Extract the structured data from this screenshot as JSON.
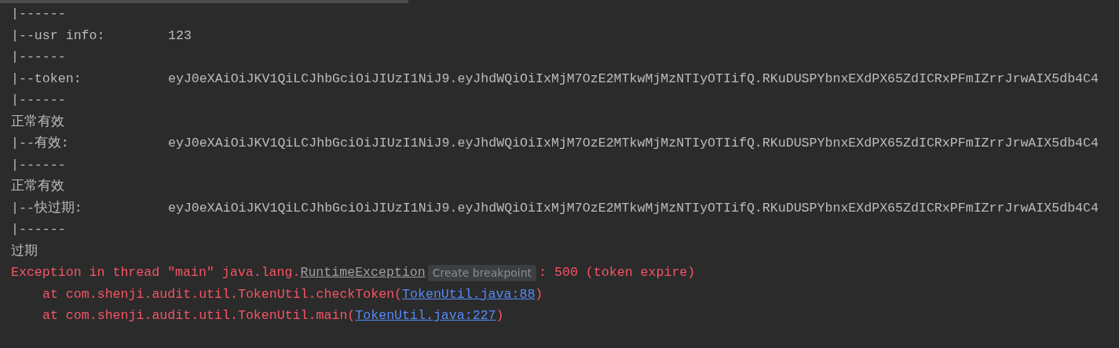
{
  "console": {
    "lines": [
      {
        "kind": "plain",
        "text": "|------"
      },
      {
        "kind": "field",
        "label": "|--usr info:",
        "value": "123"
      },
      {
        "kind": "plain",
        "text": "|------"
      },
      {
        "kind": "field",
        "label": "|--token:",
        "value": "eyJ0eXAiOiJKV1QiLCJhbGciOiJIUzI1NiJ9.eyJhdWQiOiIxMjM7OzE2MTkwMjMzNTIyOTIifQ.RKuDUSPYbnxEXdPX65ZdICRxPFmIZrrJrwAIX5db4C4"
      },
      {
        "kind": "plain",
        "text": "|------"
      },
      {
        "kind": "plain",
        "text": "正常有效"
      },
      {
        "kind": "field",
        "label": "|--有效:",
        "value": "eyJ0eXAiOiJKV1QiLCJhbGciOiJIUzI1NiJ9.eyJhdWQiOiIxMjM7OzE2MTkwMjMzNTIyOTIifQ.RKuDUSPYbnxEXdPX65ZdICRxPFmIZrrJrwAIX5db4C4"
      },
      {
        "kind": "plain",
        "text": "|------"
      },
      {
        "kind": "plain",
        "text": "正常有效"
      },
      {
        "kind": "field",
        "label": "|--快过期:",
        "value": "eyJ0eXAiOiJKV1QiLCJhbGciOiJIUzI1NiJ9.eyJhdWQiOiIxMjM7OzE2MTkwMjMzNTIyOTIifQ.RKuDUSPYbnxEXdPX65ZdICRxPFmIZrrJrwAIX5db4C4"
      },
      {
        "kind": "plain",
        "text": "|------"
      },
      {
        "kind": "plain",
        "text": "过期"
      },
      {
        "kind": "exception",
        "prefix": "Exception in thread \"main\" java.lang.",
        "link": "RuntimeException",
        "tooltip": "Create breakpoint",
        "suffix": ": 500 (token expire)"
      },
      {
        "kind": "trace",
        "prefix": "at com.shenji.audit.util.TokenUtil.checkToken(",
        "link": "TokenUtil.java:88",
        "suffix": ")"
      },
      {
        "kind": "trace",
        "prefix": "at com.shenji.audit.util.TokenUtil.main(",
        "link": "TokenUtil.java:227",
        "suffix": ")"
      }
    ]
  }
}
